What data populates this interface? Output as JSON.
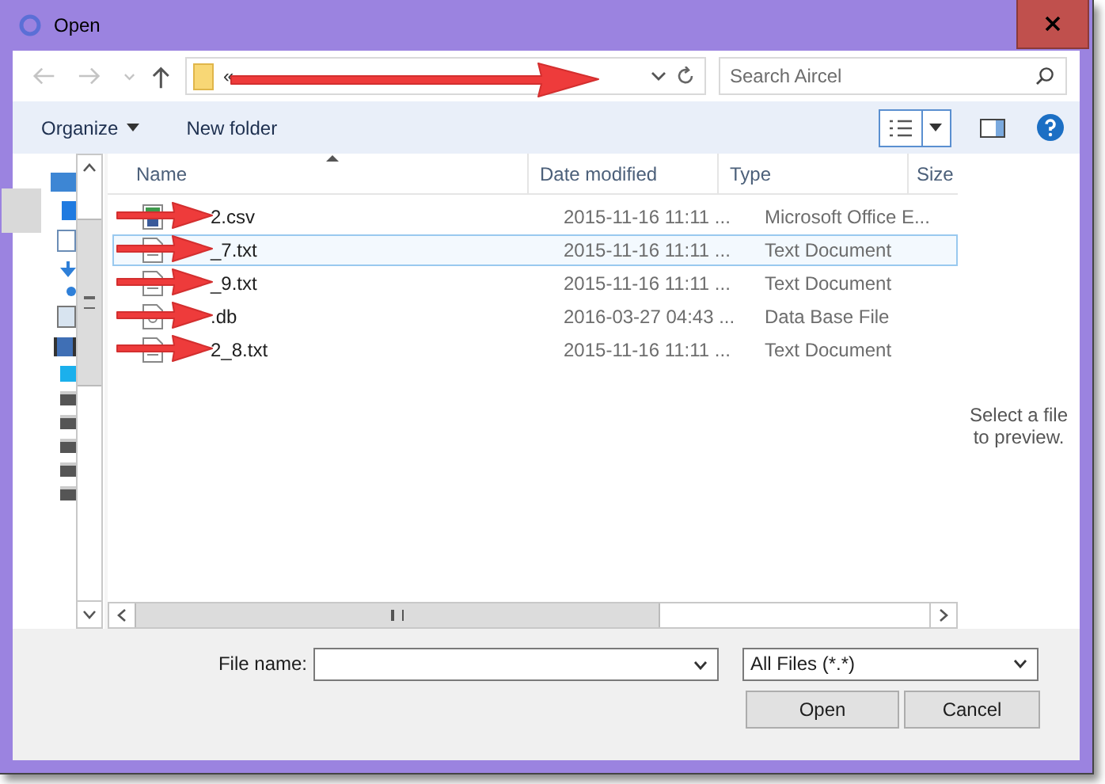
{
  "window": {
    "title": "Open"
  },
  "address_bar": {
    "path_prefix": "«",
    "arrow": true
  },
  "search": {
    "placeholder": "Search Aircel"
  },
  "toolbar": {
    "organize": "Organize",
    "new_folder": "New folder"
  },
  "table": {
    "columns": [
      "Name",
      "Date modified",
      "Type",
      "Size"
    ],
    "rows": [
      {
        "name": "2.csv",
        "date": "2015-11-16 11:11 ...",
        "type": "Microsoft Office E...",
        "kind": "csv",
        "selected": false,
        "arrow": true
      },
      {
        "name": "_7.txt",
        "date": "2015-11-16 11:11 ...",
        "type": "Text Document",
        "kind": "txt",
        "selected": true,
        "arrow": true
      },
      {
        "name": "_9.txt",
        "date": "2015-11-16 11:11 ...",
        "type": "Text Document",
        "kind": "txt",
        "selected": false,
        "arrow": true
      },
      {
        "name": ".db",
        "date": "2016-03-27 04:43 ...",
        "type": "Data Base File",
        "kind": "db",
        "selected": false,
        "arrow": true
      },
      {
        "name": "2_8.txt",
        "date": "2015-11-16 11:11 ...",
        "type": "Text Document",
        "kind": "txt",
        "selected": false,
        "arrow": true
      }
    ]
  },
  "preview": {
    "message": "Select a file to preview."
  },
  "file_name": {
    "label": "File name:"
  },
  "filter": {
    "value": "All Files (*.*)"
  },
  "buttons": [
    "Open",
    "Cancel"
  ]
}
